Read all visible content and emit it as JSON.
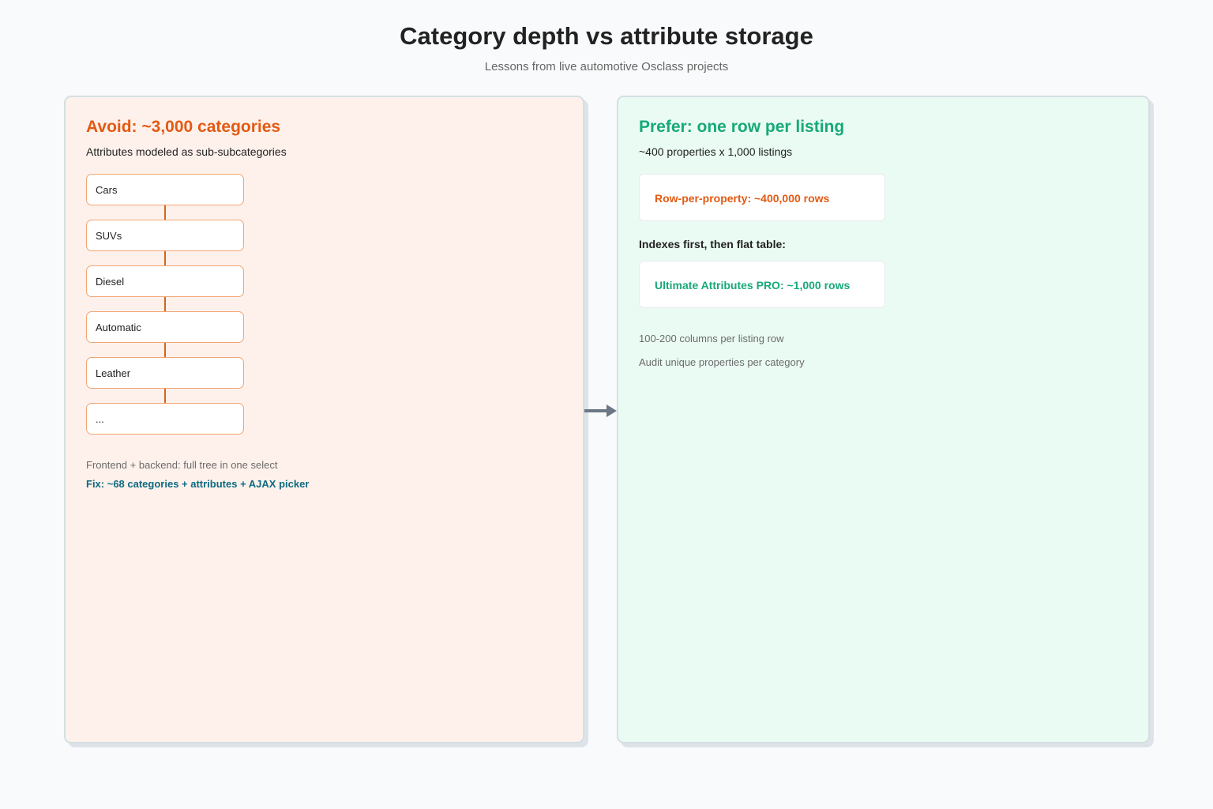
{
  "page": {
    "title": "Category depth vs attribute storage",
    "subtitle": "Lessons from live automotive Osclass projects"
  },
  "left_panel": {
    "heading": "Avoid: ~3,000 categories",
    "description": "Attributes modeled as sub-subcategories",
    "chain": [
      "Cars",
      "SUVs",
      "Diesel",
      "Automatic",
      "Leather",
      "..."
    ],
    "note": "Frontend + backend: full tree in one select",
    "fix": "Fix: ~68 categories + attributes + AJAX picker"
  },
  "right_panel": {
    "heading": "Prefer: one row per listing",
    "description": "~400 properties x 1,000 listings",
    "bad_card": "Row-per-property: ~400,000 rows",
    "section_label": "Indexes first, then flat table:",
    "good_card": "Ultimate Attributes PRO: ~1,000 rows",
    "notes": [
      "100-200 columns per listing row",
      "Audit unique properties per category"
    ]
  },
  "colors": {
    "avoid_accent": "#e35a12",
    "prefer_accent": "#17a979",
    "fix_text": "#0d6a82",
    "connector": "#d4651e",
    "arrow": "#6b7785"
  }
}
